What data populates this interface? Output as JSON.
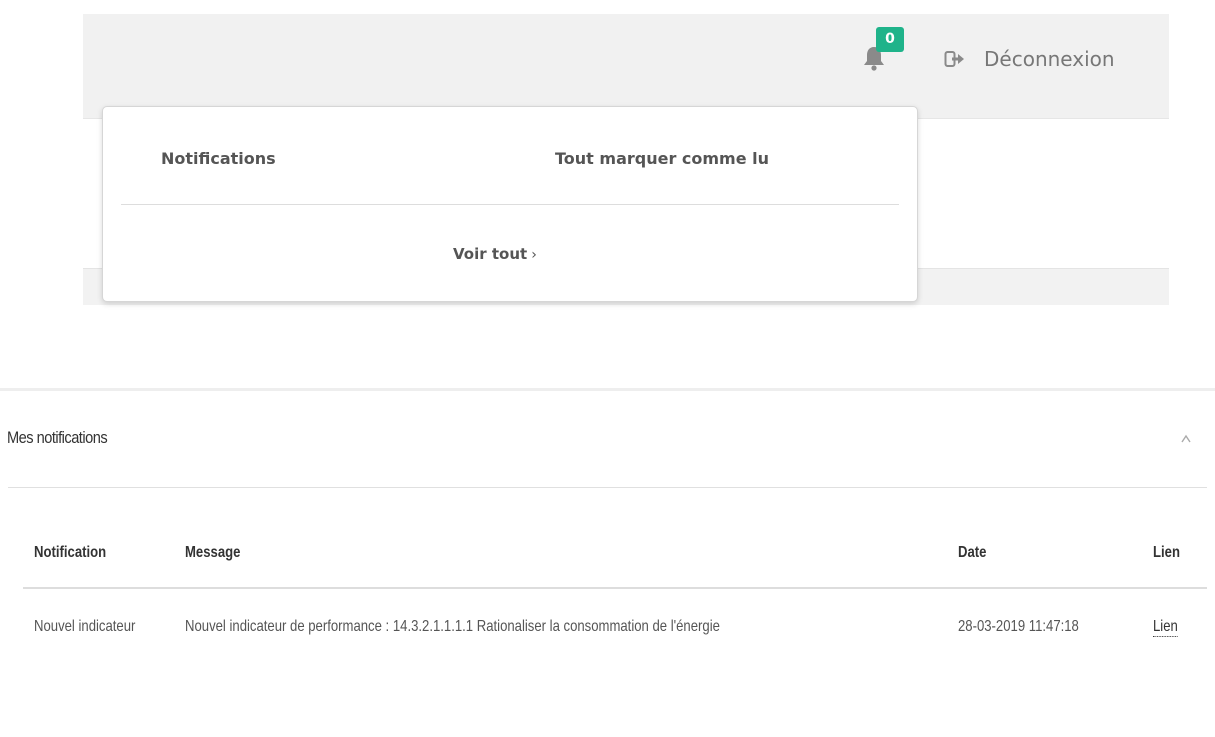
{
  "header": {
    "notification_count": "0",
    "logout_label": "Déconnexion"
  },
  "dropdown": {
    "title": "Notifications",
    "mark_all_read": "Tout marquer comme lu",
    "view_all": "Voir tout",
    "view_all_chevron": "›"
  },
  "panel": {
    "title": "Mes notifications",
    "collapse_icon": "chevron-up-icon"
  },
  "table": {
    "columns": [
      "Notification",
      "Message",
      "Date",
      "Lien"
    ],
    "rows": [
      {
        "notification": "Nouvel indicateur",
        "message": "Nouvel indicateur de performance : 14.3.2.1.1.1.1 Rationaliser la consommation de l'énergie",
        "date": "28-03-2019 11:47:18",
        "link": "Lien"
      }
    ]
  },
  "colors": {
    "badge": "#1fb38a",
    "topbar": "#f1f1f1"
  }
}
